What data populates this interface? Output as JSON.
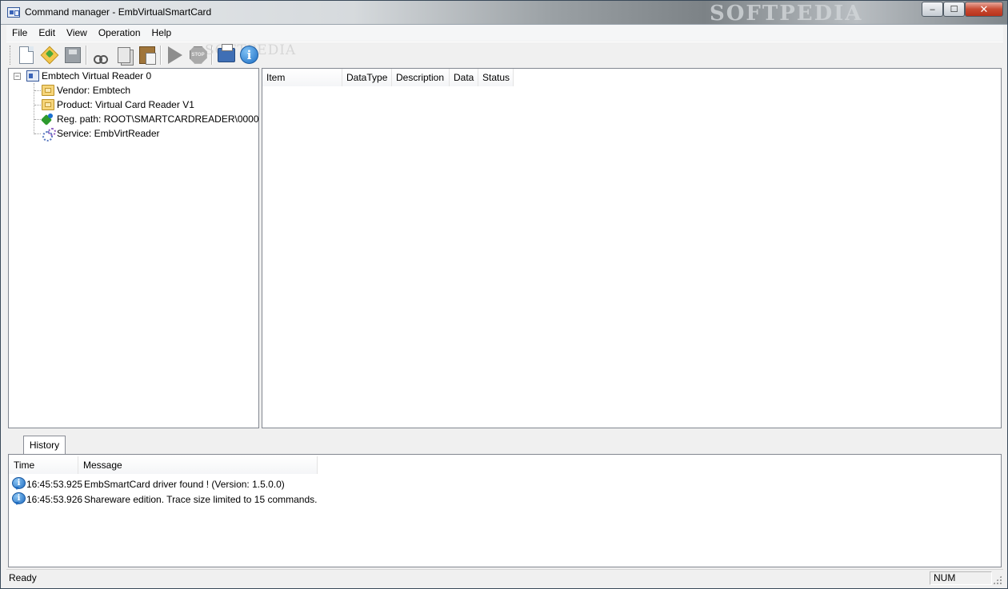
{
  "window": {
    "title": "Command manager - EmbVirtualSmartCard",
    "watermark": "SOFTPEDIA",
    "controls": {
      "minimize": "‒",
      "maximize": "☐",
      "close": "✕"
    }
  },
  "menu": [
    "File",
    "Edit",
    "View",
    "Operation",
    "Help"
  ],
  "toolbar": {
    "watermark": "SOFTPEDIA",
    "buttons": [
      "new-document",
      "open",
      "save",
      "cut",
      "copy",
      "paste",
      "run",
      "stop",
      "print",
      "about-info"
    ],
    "stop_label": "STOP",
    "info_label": "i"
  },
  "tree": {
    "root": {
      "label": "Embtech Virtual Reader 0",
      "expander": "−",
      "icon": "smartcard-reader-icon"
    },
    "children": [
      {
        "label": "Vendor: Embtech",
        "icon": "folder-icon"
      },
      {
        "label": "Product: Virtual Card Reader V1",
        "icon": "folder-icon"
      },
      {
        "label": "Reg. path: ROOT\\SMARTCARDREADER\\0000",
        "icon": "registry-key-icon"
      },
      {
        "label": "Service: EmbVirtReader",
        "icon": "service-gear-icon"
      }
    ]
  },
  "list": {
    "columns": [
      "Item",
      "DataType",
      "Description",
      "Data",
      "Status"
    ],
    "rows": []
  },
  "history": {
    "tab_label": "History",
    "columns": [
      "Time",
      "Message"
    ],
    "rows": [
      {
        "time": "16:45:53.925",
        "message": "EmbSmartCard driver found ! (Version: 1.5.0.0)"
      },
      {
        "time": "16:45:53.926",
        "message": "Shareware edition. Trace size limited to 15 commands."
      }
    ]
  },
  "status": {
    "text": "Ready",
    "num": "NUM"
  },
  "colors": {
    "close_button": "#c94b32",
    "selection_accent": "#1e6fc4"
  }
}
